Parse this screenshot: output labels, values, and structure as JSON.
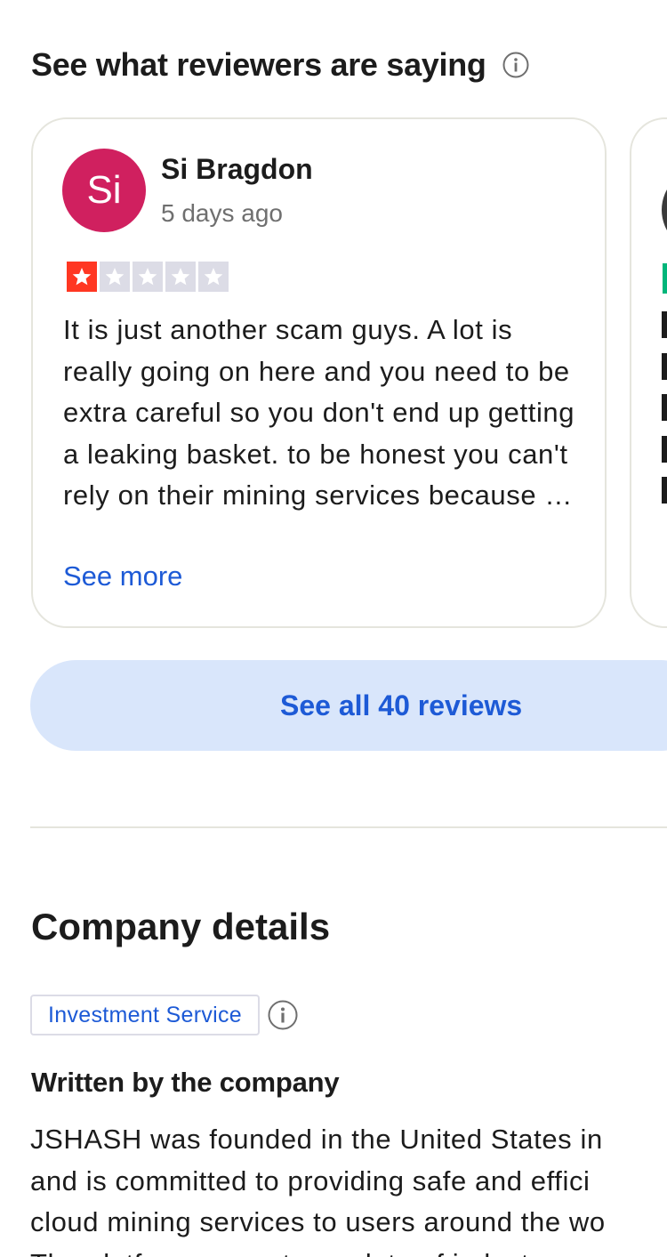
{
  "reviews_section": {
    "title": "See what reviewers are saying",
    "info_icon": "info-icon",
    "review": {
      "avatar_initials": "Si",
      "avatar_color": "#d0205f",
      "reviewer_name": "Si Bragdon",
      "date": "5 days ago",
      "rating": 1,
      "max_rating": 5,
      "star_color_filled": "#ff3722",
      "star_color_empty": "#dcdce6",
      "text": "It is just another scam guys. A lot is really going on here and you need to be extra careful so you don't end up getting a leaking basket. to be honest you can't rely on their mining services because …",
      "see_more_label": "See more"
    },
    "see_all_label": "See all 40 reviews"
  },
  "company_details": {
    "title": "Company details",
    "category_tag": "Investment Service",
    "info_icon": "info-icon",
    "written_by_title": "Written by the company",
    "description_lines": [
      "JSHASH was founded in the United States in",
      "and is committed to providing safe and effici",
      "cloud mining services to users around the wo",
      "The platform uses strong data of industry"
    ]
  },
  "colors": {
    "accent": "#1d5ad6",
    "button_bg": "#d9e6fb",
    "border": "#e5e5dd"
  }
}
